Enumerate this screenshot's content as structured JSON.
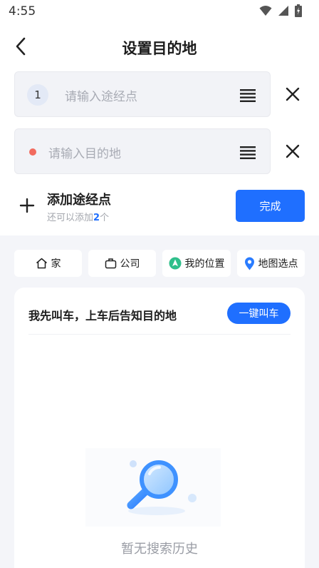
{
  "status_bar": {
    "time": "4:55"
  },
  "header": {
    "title": "设置目的地"
  },
  "inputs": {
    "waypoint": {
      "index": "1",
      "placeholder": "请输入途经点"
    },
    "destination": {
      "placeholder": "请输入目的地"
    }
  },
  "add_waypoint": {
    "label": "添加途经点",
    "sub_prefix": "还可以添加",
    "sub_count": "2",
    "sub_suffix": "个"
  },
  "done_button": "完成",
  "quick_chips": [
    {
      "label": "家",
      "icon": "home-icon"
    },
    {
      "label": "公司",
      "icon": "briefcase-icon"
    },
    {
      "label": "我的位置",
      "icon": "navigation-arrow-icon"
    },
    {
      "label": "地图选点",
      "icon": "map-pin-icon"
    }
  ],
  "card": {
    "text": "我先叫车，上车后告知目的地",
    "button": "一键叫车",
    "empty_text": "暂无搜索历史"
  },
  "colors": {
    "accent": "#1f6fff",
    "destination_dot": "#f26b5e",
    "nav_green": "#2fbf8b",
    "pin_blue": "#2a7cff"
  }
}
